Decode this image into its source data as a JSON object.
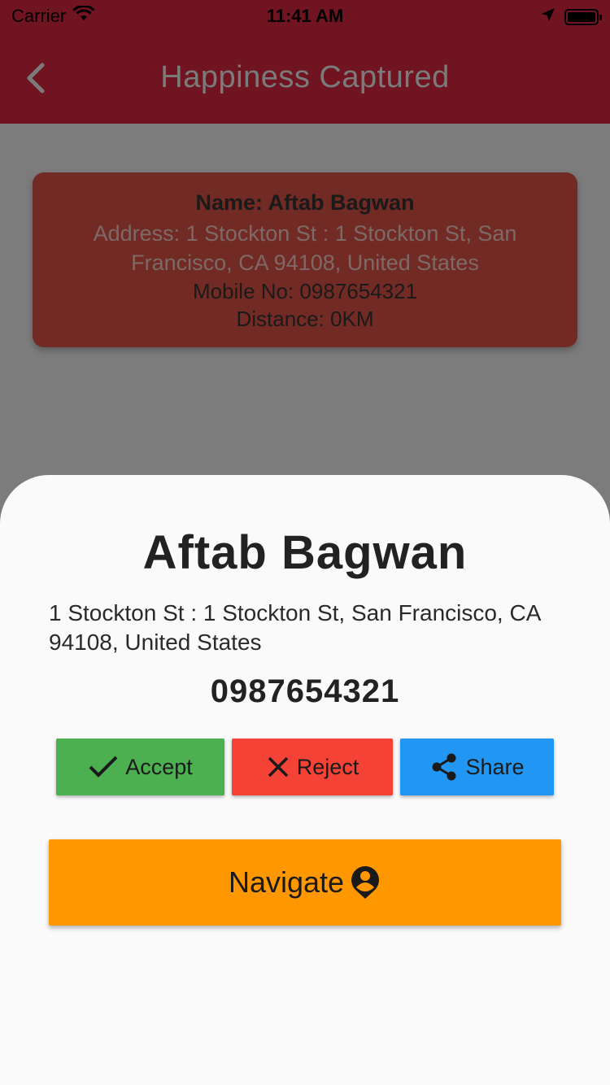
{
  "status_bar": {
    "carrier": "Carrier",
    "time": "11:41 AM"
  },
  "app_bar": {
    "title": "Happiness Captured"
  },
  "card": {
    "name": "Name: Aftab Bagwan",
    "address": "Address: 1 Stockton St : 1 Stockton St, San Francisco, CA  94108, United States",
    "mobile": "Mobile No: 0987654321",
    "distance": "Distance: 0KM"
  },
  "sheet": {
    "name": "Aftab Bagwan",
    "address": "1 Stockton St : 1 Stockton St, San Francisco, CA  94108, United States",
    "phone": "0987654321",
    "accept_label": "Accept",
    "reject_label": "Reject",
    "share_label": "Share",
    "navigate_label": "Navigate"
  },
  "colors": {
    "app_bar": "#701421",
    "card": "#722a24",
    "accept": "#4caf50",
    "reject": "#f44336",
    "share": "#2196f3",
    "navigate": "#ff9800"
  },
  "icons": {
    "back": "chevron-left-icon",
    "accept": "check-icon",
    "reject": "close-icon",
    "share": "share-icon",
    "navigate": "person-pin-icon"
  }
}
